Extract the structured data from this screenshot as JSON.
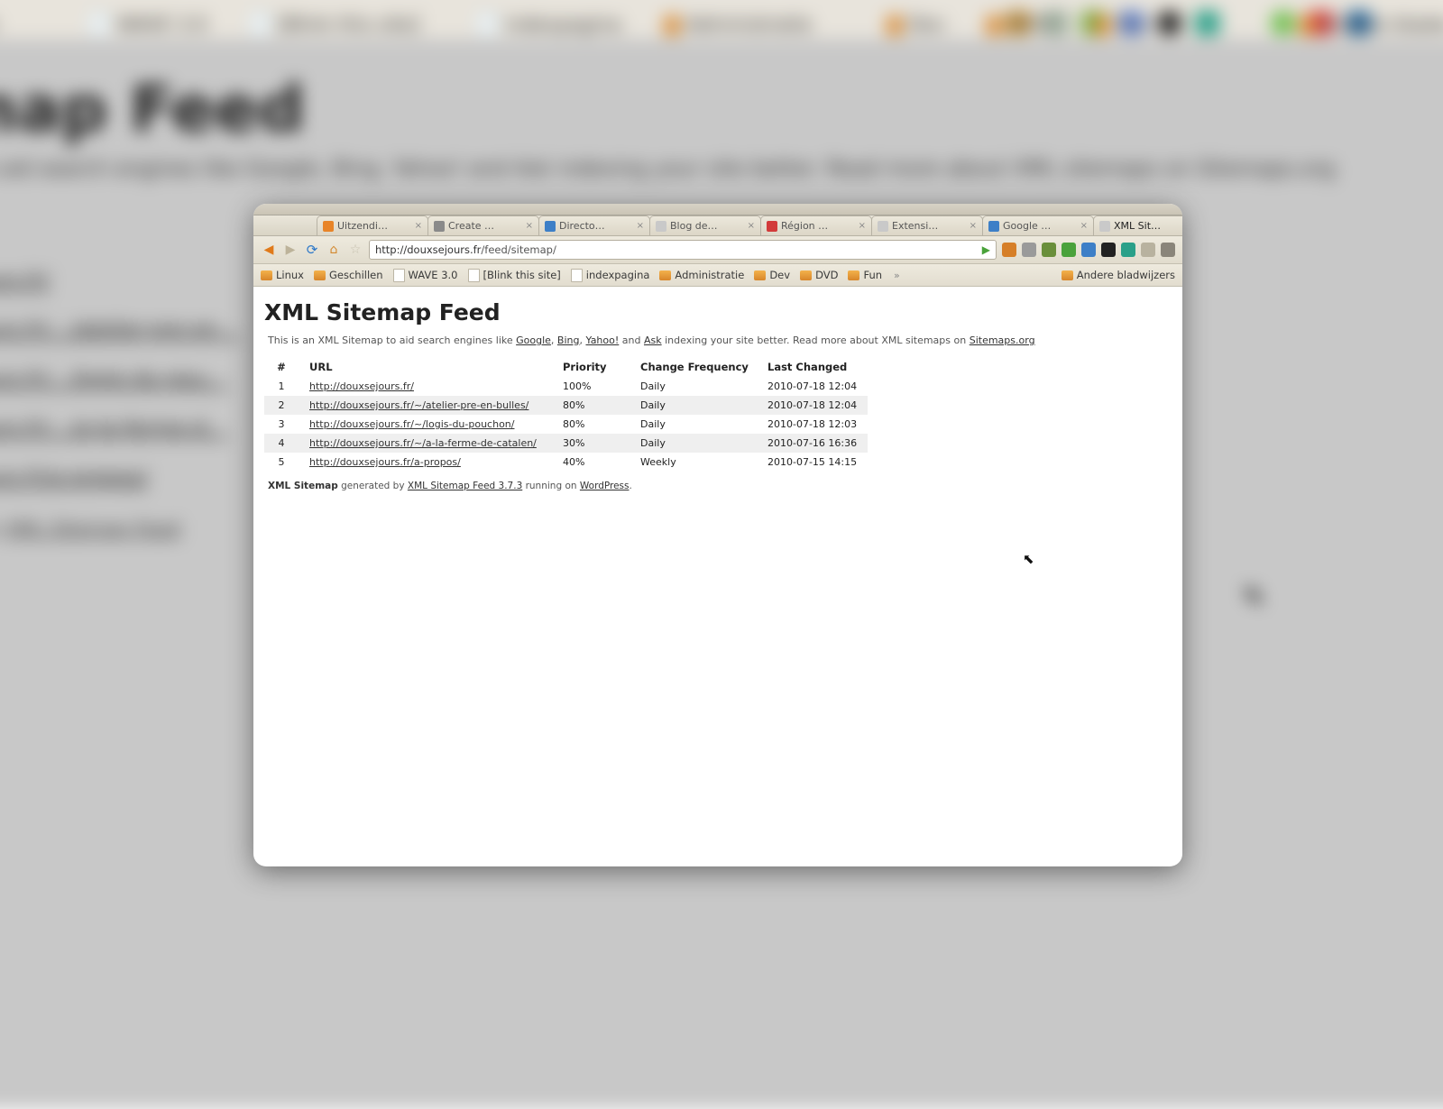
{
  "bg": {
    "title_suffix": "emap Feed",
    "intro": "emap to aid search engines like Google, Bing, Yahoo! and Ask indexing your site better. Read more about XML sitemaps on Sitemaps.org",
    "list": [
      "ouxsejours.fr/",
      "ouxsejours.fr/…/atelier-pre-en…",
      "ouxsejours.fr/…/logis-du-pou…",
      "ouxsejours.fr/…/a-la-ferme-d…",
      "ouxsejours.fr/a-propos/"
    ],
    "footer_a": "XML Sitemap Feed",
    "bookmarks": [
      "schillen",
      "WAVE 3.0",
      "[Blink this site]",
      "indexpagina",
      "Administratie",
      "Dev",
      "DVD",
      "Fun",
      "Andere bladw"
    ]
  },
  "tabs": [
    {
      "label": "Uitzendi…",
      "color": "#e88428"
    },
    {
      "label": "Create …",
      "color": "#8a8a8a"
    },
    {
      "label": "Directo…",
      "color": "#3d7fc7"
    },
    {
      "label": "Blog de…",
      "color": "#c9c9c9"
    },
    {
      "label": "Région …",
      "color": "#d23a3a"
    },
    {
      "label": "Extensi…",
      "color": "#c9c9c9"
    },
    {
      "label": "Google …",
      "color": "#3d7fc7"
    },
    {
      "label": "XML Sit…",
      "color": "#c9c9c9",
      "active": true
    }
  ],
  "newtab_glyph": "+",
  "nav": {
    "back": "◀",
    "fwd": "▶",
    "reload": "⟳",
    "home": "⌂",
    "star": "☆",
    "go": "▶",
    "url_host": "http://douxsejours.fr",
    "url_path": "/feed/sitemap/"
  },
  "toolbar_icons": [
    {
      "name": "plugin-icon",
      "color": "#d67f28"
    },
    {
      "name": "mail-icon",
      "color": "#9a9a9a"
    },
    {
      "name": "leaf-icon",
      "color": "#6a8f3b"
    },
    {
      "name": "bug-icon",
      "color": "#4aa23c"
    },
    {
      "name": "globe-icon",
      "color": "#3d7fc7"
    },
    {
      "name": "record-icon",
      "color": "#222"
    },
    {
      "name": "dash-icon",
      "color": "#2aa089"
    },
    {
      "name": "page-icon",
      "color": "#b8b29f"
    },
    {
      "name": "wrench-icon",
      "color": "#8a857a"
    }
  ],
  "bookmarks": [
    {
      "icon": "f",
      "label": "Linux"
    },
    {
      "icon": "f",
      "label": "Geschillen"
    },
    {
      "icon": "p",
      "label": "WAVE 3.0"
    },
    {
      "icon": "p",
      "label": "[Blink this site]"
    },
    {
      "icon": "p",
      "label": "indexpagina"
    },
    {
      "icon": "f",
      "label": "Administratie"
    },
    {
      "icon": "f",
      "label": "Dev"
    },
    {
      "icon": "f",
      "label": "DVD"
    },
    {
      "icon": "f",
      "label": "Fun"
    }
  ],
  "bookmarks_more": "»",
  "bookmarks_right": {
    "icon": "f",
    "label": "Andere bladwijzers"
  },
  "page": {
    "h1": "XML Sitemap Feed",
    "intro_pre": "This is an XML Sitemap to aid search engines like ",
    "links": [
      "Google",
      "Bing",
      "Yahoo!",
      "Ask"
    ],
    "intro_mid": " indexing your site better. Read more about XML sitemaps on ",
    "intro_end_link": "Sitemaps.org",
    "columns": [
      "#",
      "URL",
      "Priority",
      "Change Frequency",
      "Last Changed"
    ],
    "rows": [
      {
        "n": "1",
        "url": "http://douxsejours.fr/",
        "pri": "100%",
        "freq": "Daily",
        "date": "2010-07-18 12:04"
      },
      {
        "n": "2",
        "url": "http://douxsejours.fr/~/atelier-pre-en-bulles/",
        "pri": "80%",
        "freq": "Daily",
        "date": "2010-07-18 12:04"
      },
      {
        "n": "3",
        "url": "http://douxsejours.fr/~/logis-du-pouchon/",
        "pri": "80%",
        "freq": "Daily",
        "date": "2010-07-18 12:03"
      },
      {
        "n": "4",
        "url": "http://douxsejours.fr/~/a-la-ferme-de-catalen/",
        "pri": "30%",
        "freq": "Daily",
        "date": "2010-07-16 16:36"
      },
      {
        "n": "5",
        "url": "http://douxsejours.fr/a-propos/",
        "pri": "40%",
        "freq": "Weekly",
        "date": "2010-07-15 14:15"
      }
    ],
    "footer_strong": "XML Sitemap",
    "footer_mid": " generated by ",
    "footer_link1": "XML Sitemap Feed 3.7.3",
    "footer_mid2": " running on ",
    "footer_link2": "WordPress",
    "footer_end": "."
  }
}
